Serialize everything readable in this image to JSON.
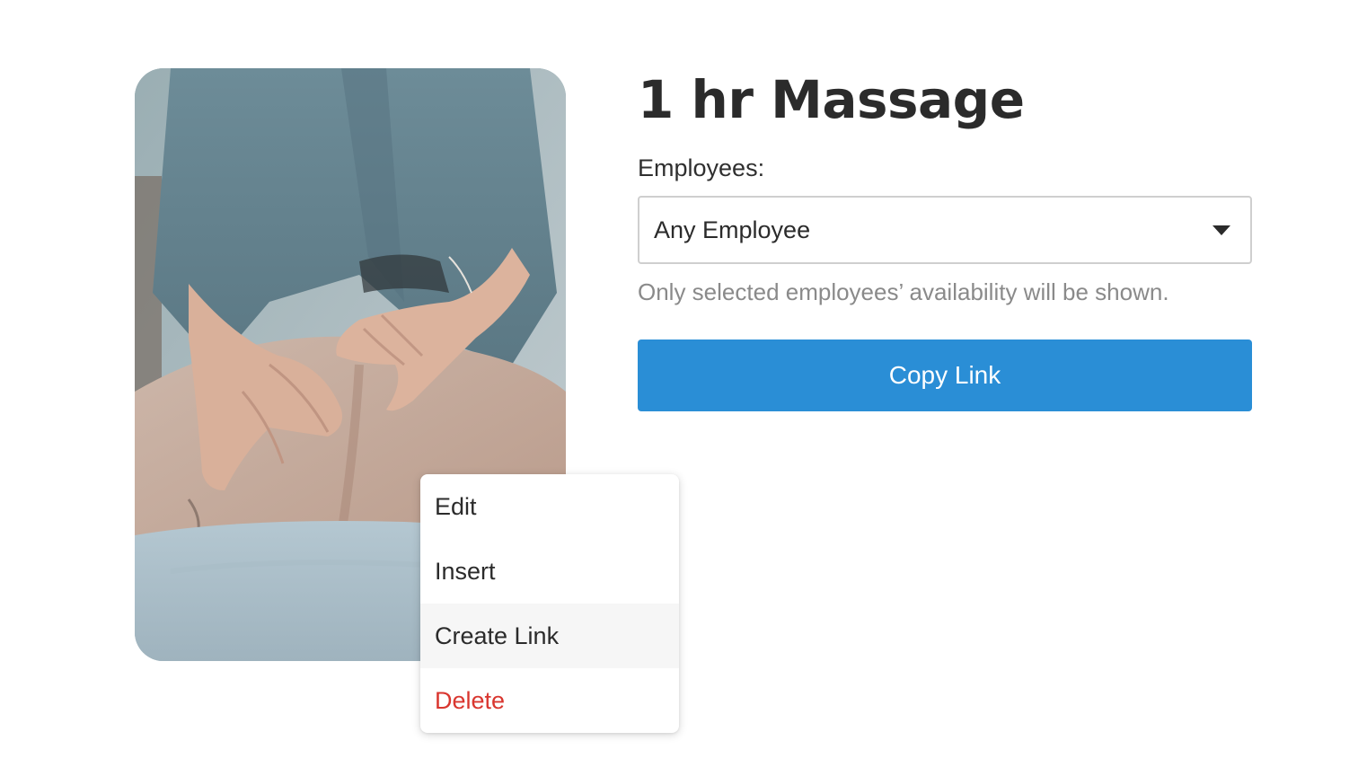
{
  "service": {
    "title": "1 hr Massage"
  },
  "employees": {
    "label": "Employees:",
    "selected": "Any Employee",
    "helper": "Only selected employees’ availability will be shown."
  },
  "actions": {
    "copy_link": "Copy Link"
  },
  "context_menu": {
    "items": [
      {
        "label": "Edit"
      },
      {
        "label": "Insert"
      },
      {
        "label": "Create Link",
        "highlighted": true
      },
      {
        "label": "Delete",
        "color": "#d9362f"
      }
    ]
  },
  "colors": {
    "primary": "#2a8ed6",
    "danger": "#d9362f",
    "text": "#2b2b2b",
    "muted": "#8a8a8a"
  },
  "icons": {
    "select_caret": "caret-down-icon"
  }
}
